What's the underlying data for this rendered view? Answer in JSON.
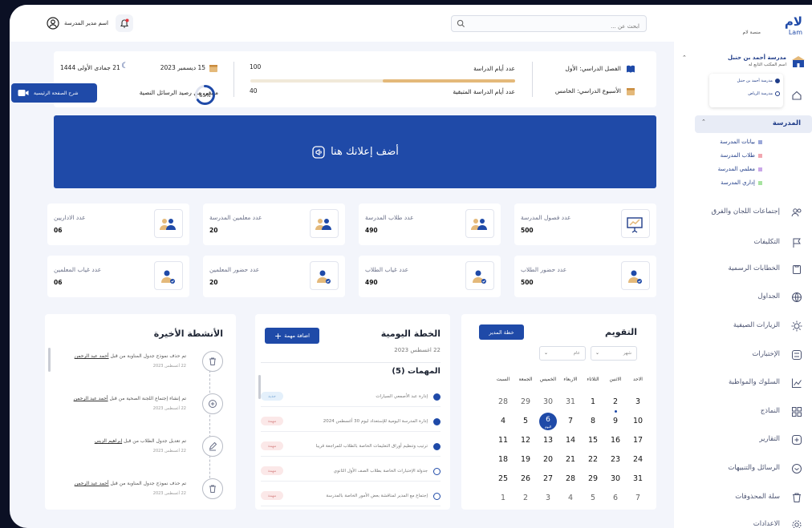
{
  "brand": {
    "name_ar": "لام",
    "name_en": "Lam",
    "caption": "منصة لام"
  },
  "search": {
    "placeholder": "ابحث عن ..."
  },
  "user": {
    "name": "اسم مدير المدرسة"
  },
  "sidebar": {
    "school_name": "مدرسة أحمد بن حنبل",
    "school_sub": "اسم المكتب التابع له",
    "school_options": [
      "مدرسة أحمد بن حنبل",
      "مدرسة الرياض"
    ],
    "section": "المدرسة",
    "sub_items": [
      {
        "label": "بيانات المدرسة",
        "color": "#9aa7d9"
      },
      {
        "label": "طلاب المدرسة",
        "color": "#f2a7b0"
      },
      {
        "label": "معلمي المدرسة",
        "color": "#c9a7e8"
      },
      {
        "label": "إداري المدرسة",
        "color": "#a7e3a0"
      }
    ],
    "items": [
      "إجتماعات اللجان والفرق",
      "التكليفات",
      "الخطابات الرسمية",
      "الجداول",
      "الزيارات الصيفية",
      "الإختبارات",
      "السلوك والمواظبة",
      "النماذج",
      "التقارير",
      "الرسائل والتنبيهات",
      "سلة المحذوفات",
      "الاعدادات"
    ]
  },
  "info": {
    "semester": "الفصل الدراسي: الأول",
    "week": "الأسبوع الدراسي: الخامس",
    "days_label": "عدد أيام الدراسة",
    "days_value": "100",
    "days_progress": 0.5,
    "remaining_label": "عدد أيام الدراسة المتبقية",
    "remaining_value": "40",
    "date_greg": "15 ديسمبر 2023",
    "date_hijri": "21 جمادى الأولى 1444",
    "messages_label": "متبقي من رصيد الرسائل النصية",
    "messages_percent": "65%",
    "messages_fraction": 0.65
  },
  "guide_button": "شرح الصفحة الرئيسية",
  "promo": {
    "text": "أضف إعلانك هنا"
  },
  "stats": [
    {
      "label": "عدد فصول المدرسة",
      "value": "500"
    },
    {
      "label": "عدد طلاب المدرسة",
      "value": "490"
    },
    {
      "label": "عدد معلمين المدرسة",
      "value": "20"
    },
    {
      "label": "عدد الاداريين",
      "value": "06"
    },
    {
      "label": "عدد حضور الطلاب",
      "value": "500"
    },
    {
      "label": "عدد غياب الطلاب",
      "value": "490"
    },
    {
      "label": "عدد حضور المعلمين",
      "value": "20"
    },
    {
      "label": "عدد غياب المعلمين",
      "value": "06"
    }
  ],
  "calendar": {
    "title": "التقويم",
    "plan_button": "خطة المدير",
    "month_select": "شهر",
    "year_select": "عام",
    "day_names": [
      "الاحد",
      "الاثنين",
      "الثلاثاء",
      "الاربعاء",
      "الخميس",
      "الجمعة",
      "السبت"
    ],
    "weeks": [
      [
        "3",
        "2",
        "1",
        "31",
        "30",
        "29",
        "28"
      ],
      [
        "10",
        "9",
        "8",
        "7",
        "6",
        "5",
        "4"
      ],
      [
        "17",
        "16",
        "15",
        "14",
        "13",
        "12",
        "11"
      ],
      [
        "24",
        "23",
        "22",
        "21",
        "20",
        "19",
        "18"
      ],
      [
        "31",
        "30",
        "29",
        "28",
        "27",
        "26",
        "25"
      ],
      [
        "7",
        "6",
        "5",
        "4",
        "3",
        "2",
        "1"
      ]
    ],
    "today_label": "اليوم"
  },
  "plan": {
    "title": "الخطة اليومية",
    "date": "22 اغسطس 2023",
    "add_button": "اضافة مهمة",
    "tasks_title": "المهمات (5)",
    "tasks": [
      {
        "text": "إدارة عبد الأصمعي السيارات",
        "tag": "جديد",
        "done": true
      },
      {
        "text": "إدارة المدرسة اليومية للإستعداد ليوم 30 أغسطس 2024",
        "tag": "مهمة",
        "done": true
      },
      {
        "text": "ترتيب وتنظيم أوراق التعليمات الخاصة بالطلاب للمراجعة قريبا",
        "tag": "مهمة",
        "done": true
      },
      {
        "text": "جدولة الإختبارات الخاصة بطلاب الصف الأول الثانوي",
        "tag": "مهمة",
        "done": false
      },
      {
        "text": "إجتماع مع المدير لمناقشة بعض الأمور الخاصة بالمدرسة",
        "tag": "مهمة",
        "done": false
      }
    ]
  },
  "activities": {
    "title": "الأنشطة الأخيرة",
    "items": [
      {
        "text": "تم حذف نموذج جدول المناوبة من قبل",
        "by": "أحمد عبد الرحمن",
        "date": "22 أغسطس 2023",
        "icon": "trash-icon"
      },
      {
        "text": "تم إنشاء إجتماع اللجنة الصحية من قبل",
        "by": "أحمد عبد الرحمن",
        "date": "22 أغسطس 2023",
        "icon": "plus-icon"
      },
      {
        "text": "تم تعديل جدول الطلاب من قبل",
        "by": "إبراهيم الزيني",
        "date": "22 أغسطس 2023",
        "icon": "edit-icon"
      },
      {
        "text": "تم حذف نموذج جدول المناوبة من قبل",
        "by": "أحمد عبد الرحمن",
        "date": "22 أغسطس 2023",
        "icon": "trash-icon"
      }
    ]
  },
  "colors": {
    "primary": "#1f4aa8",
    "accent": "#e4b97a",
    "bg": "#f3f5fb"
  }
}
